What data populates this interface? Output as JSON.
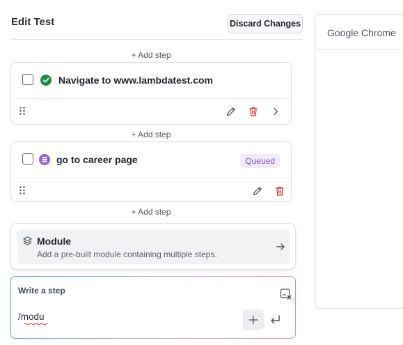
{
  "header": {
    "title": "Edit Test",
    "discard_label": "Discard Changes"
  },
  "add_step_label": "+ Add step",
  "steps": [
    {
      "text": "Navigate to www.lambdatest.com",
      "status": "success",
      "status_color": "#1e8a4a"
    },
    {
      "text": "go to career page",
      "status": "queued",
      "badge": "Queued",
      "status_color": "#7a47d6"
    }
  ],
  "module": {
    "title": "Module",
    "description": "Add a pre-built module containing multiple steps."
  },
  "composer": {
    "label": "Write a step",
    "value": "/modu"
  },
  "browser": {
    "title": "Google Chrome"
  },
  "colors": {
    "delete": "#d0343a",
    "accent_purple": "#7a47d6",
    "success_green": "#1e8a4a"
  }
}
